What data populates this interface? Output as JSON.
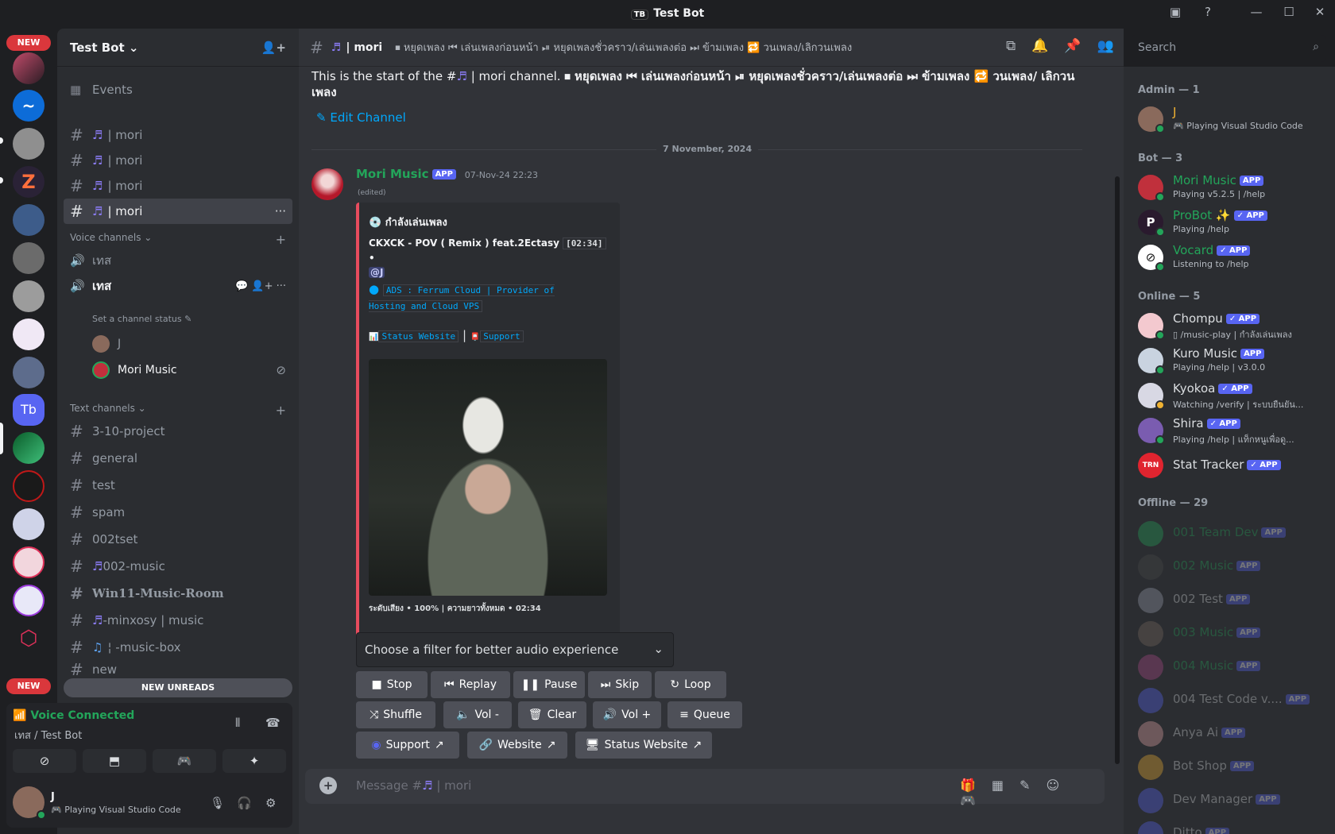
{
  "window": {
    "title": "Test Bot",
    "app_badge": "TB"
  },
  "servers": {
    "new_label": "NEW"
  },
  "guild": {
    "name": "Test Bot",
    "events_label": "Events"
  },
  "channels": {
    "music_rows": [
      {
        "label": "| mori"
      },
      {
        "label": "| mori"
      },
      {
        "label": "| mori"
      },
      {
        "label": "| mori"
      }
    ],
    "voice_category": "Voice channels",
    "voice_1": "เทส",
    "voice_2": "เทส",
    "voice_status_hint": "Set a channel status",
    "voice_users": [
      {
        "name": "J"
      },
      {
        "name": "Mori Music"
      }
    ],
    "text_category": "Text channels",
    "text": [
      {
        "label": "3-10-project"
      },
      {
        "label": "general"
      },
      {
        "label": "test"
      },
      {
        "label": "spam"
      },
      {
        "label": "002tset"
      },
      {
        "label": "002-music"
      },
      {
        "label": "Win11-Music-Room"
      },
      {
        "label": "-minxosy | music"
      },
      {
        "label": "¦ -music-box"
      },
      {
        "label": "new"
      }
    ],
    "new_unreads": "NEW UNREADS"
  },
  "voice_panel": {
    "status": "Voice Connected",
    "location": "เทส / Test Bot"
  },
  "user": {
    "name": "J",
    "activity": "Playing Visual Studio Code"
  },
  "header": {
    "channel": "| mori",
    "topic": "⏹ หยุดเพลง ⏮ เล่นเพลงก่อนหน้า ⏯ หยุดเพลงชั่วคราว/เล่นเพลงต่อ ⏭ ข้ามเพลง 🔁 วนเพลง/เลิกวนเพลง"
  },
  "search": {
    "placeholder": "Search"
  },
  "chat": {
    "intro_prefix": "This is the start of the #",
    "intro_channel": "| mori channel.",
    "intro_topic": "⏹ หยุดเพลง ⏮ เล่นเพลงก่อนหน้า ⏯ หยุดเพลงชั่วคราว/เล่นเพลงต่อ ⏭ ข้ามเพลง 🔁 วนเพลง/ เลิกวนเพลง",
    "edit_channel": "Edit Channel",
    "date_divider": "7 November, 2024",
    "message": {
      "author": "Mori Music",
      "badge": "APP",
      "timestamp": "07-Nov-24 22:23",
      "edited": "(edited)",
      "embed": {
        "heading": "กำลังเล่นเพลง",
        "song": "CKXCK - POV ( Remix ) feat.2Ectasy",
        "duration": "[02:34]",
        "bullet": "•",
        "mention": "@J",
        "ads": "ADS : Ferrum Cloud | Provider of Hosting and Cloud VPS",
        "status_link": "Status Website",
        "support_link": "Support",
        "footer": "ระดับเสียง • 100% | ความยาวทั้งหมด • 02:34"
      }
    },
    "filter_placeholder": "Choose a filter for better audio experience",
    "buttons": {
      "stop": "Stop",
      "replay": "Replay",
      "pause": "Pause",
      "skip": "Skip",
      "loop": "Loop",
      "shuffle": "Shuffle",
      "vol_down": "Vol -",
      "clear": "Clear",
      "vol_up": "Vol +",
      "queue": "Queue",
      "support": "Support",
      "website": "Website",
      "status_website": "Status Website"
    },
    "composer_placeholder": "Message #",
    "composer_channel": "| mori"
  },
  "members": {
    "admin_header": "Admin — 1",
    "bot_header": "Bot — 3",
    "online_header": "Online — 5",
    "offline_header": "Offline — 29",
    "admin": [
      {
        "name": "J",
        "status": "Playing Visual Studio Code",
        "color": "#f0b232"
      }
    ],
    "bots": [
      {
        "name": "Mori Music",
        "status": "Playing v5.2.5 | /help",
        "color": "#23a55a",
        "badge": "APP"
      },
      {
        "name": "ProBot ✨",
        "status": "Playing /help",
        "color": "#23a55a",
        "badge": "✓ APP"
      },
      {
        "name": "Vocard",
        "status": "Listening to /help",
        "color": "#23a55a",
        "badge": "✓ APP"
      }
    ],
    "online": [
      {
        "name": "Chompu",
        "status": "▯ /music-play | กำลังเล่นเพลง",
        "badge": "✓ APP"
      },
      {
        "name": "Kuro Music",
        "status": "Playing /help | v3.0.0",
        "badge": "APP"
      },
      {
        "name": "Kyokoa",
        "status": "Watching /verify | ระบบยืนยัน...",
        "badge": "✓ APP"
      },
      {
        "name": "Shira",
        "status": "Playing /help | แท็กหนูเพื่อดู...",
        "badge": "✓ APP"
      },
      {
        "name": "Stat Tracker",
        "status": "",
        "badge": "✓ APP"
      }
    ],
    "offline": [
      {
        "name": "001 Team Dev",
        "badge": "APP"
      },
      {
        "name": "002 Music",
        "badge": "APP"
      },
      {
        "name": "002 Test",
        "badge": "APP"
      },
      {
        "name": "003 Music",
        "badge": "APP"
      },
      {
        "name": "004 Music",
        "badge": "APP"
      },
      {
        "name": "004 Test Code v....",
        "badge": "APP"
      },
      {
        "name": "Anya Ai",
        "badge": "APP"
      },
      {
        "name": "Bot Shop",
        "badge": "APP"
      },
      {
        "name": "Dev Manager",
        "badge": "APP"
      },
      {
        "name": "Ditto",
        "badge": "APP"
      }
    ]
  },
  "colors": {
    "accent": "#5865f2",
    "online": "#23a55a",
    "embed_bar": "#e74c5e",
    "bot_name": "#23a55a",
    "link": "#00a8fc"
  }
}
